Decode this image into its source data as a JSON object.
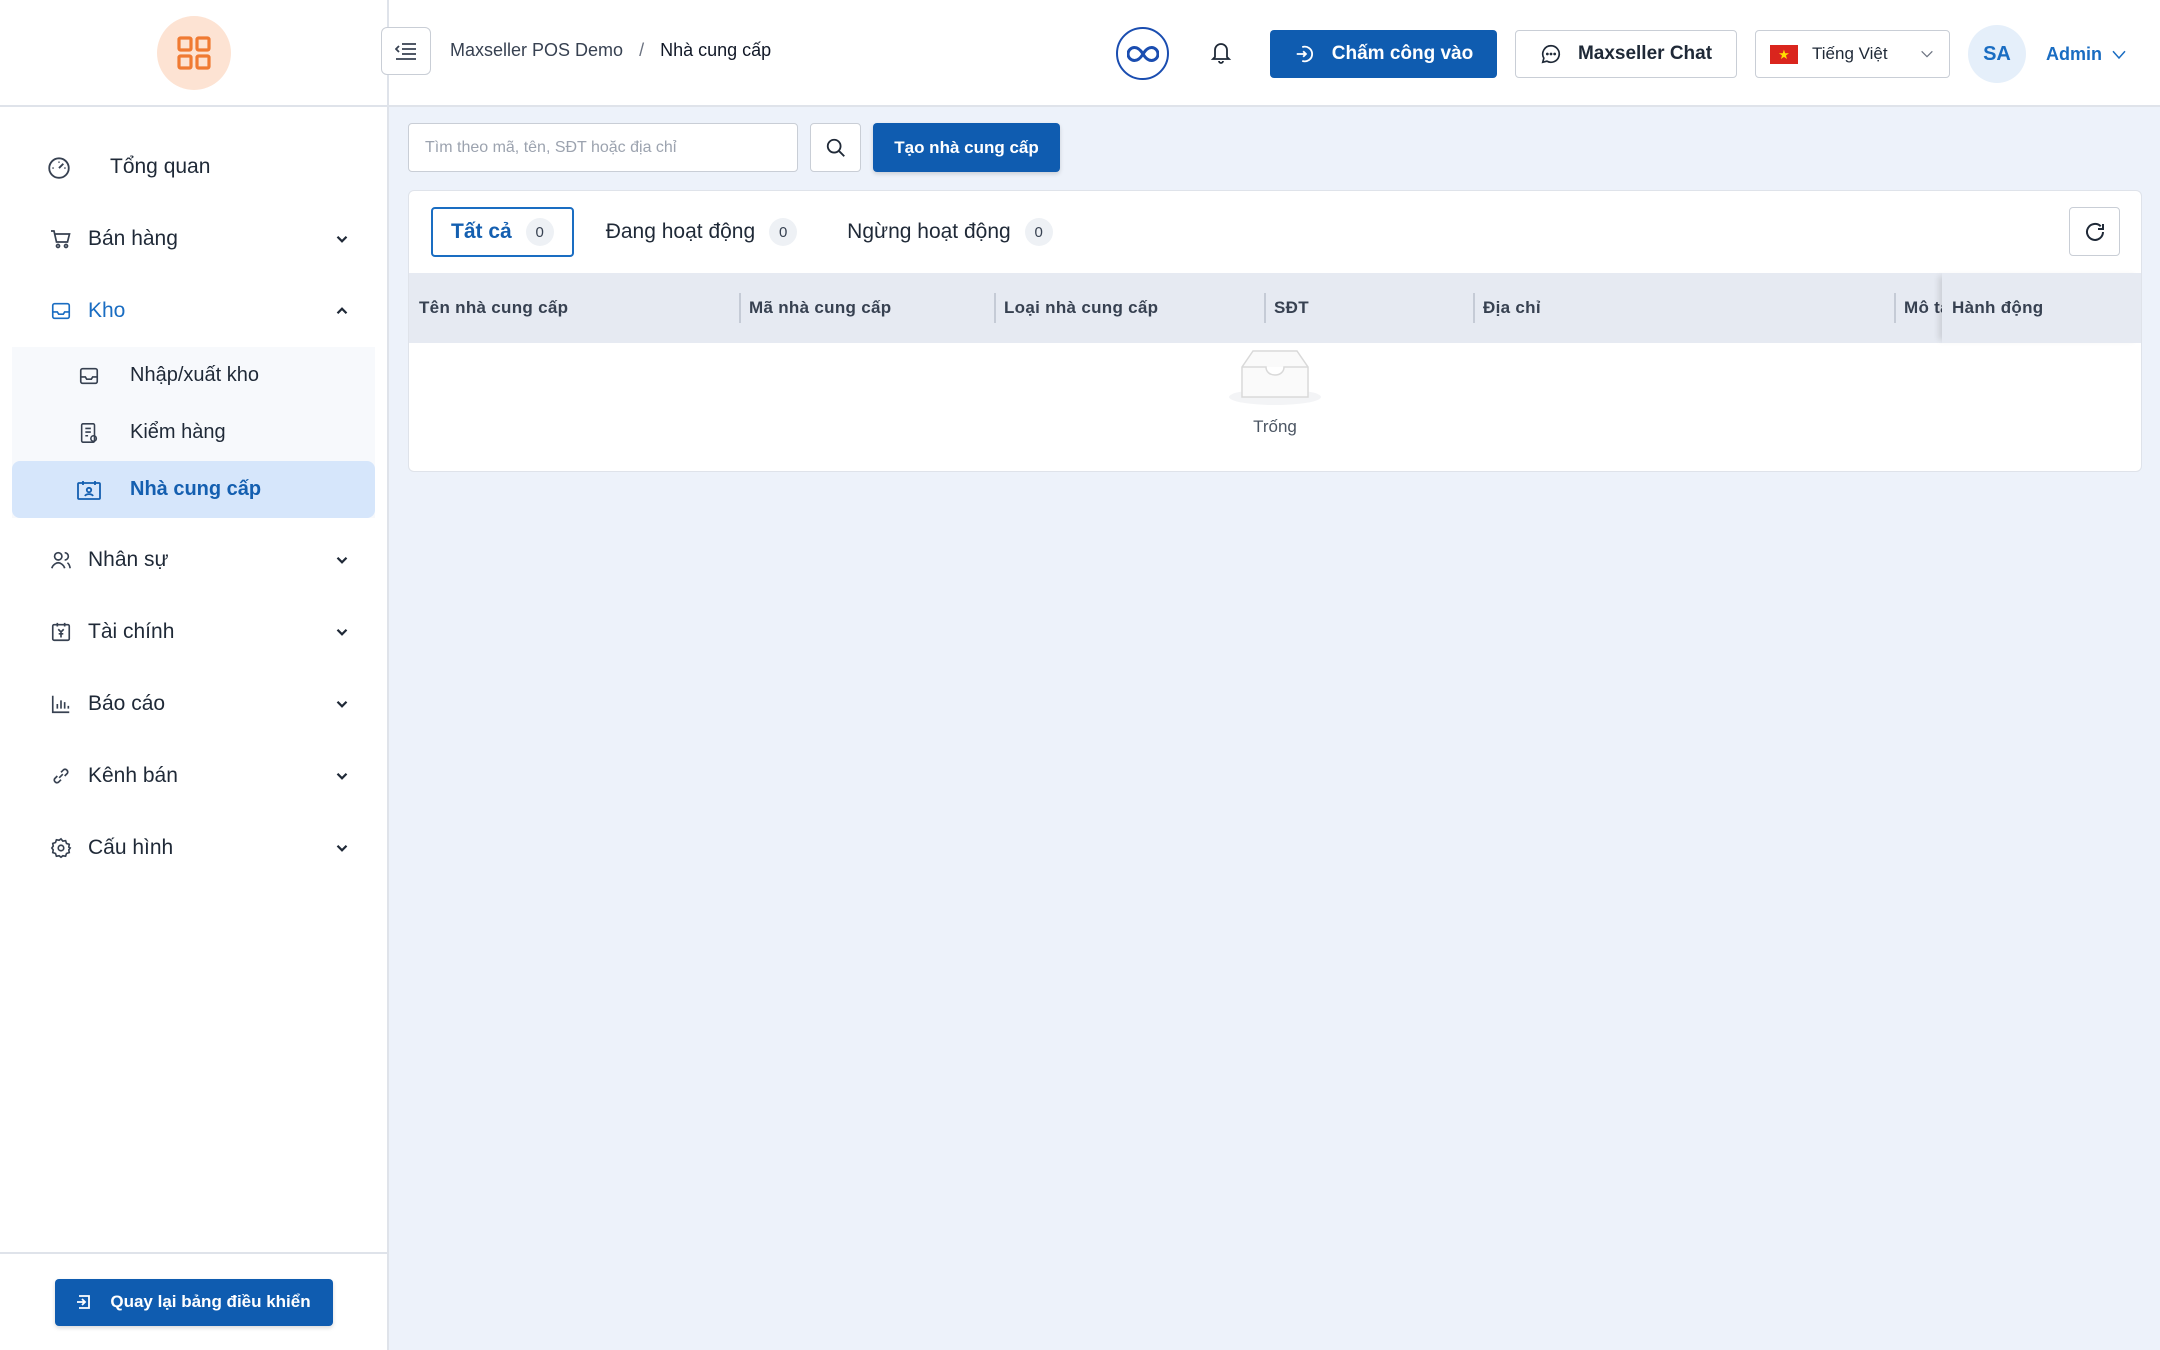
{
  "header": {
    "breadcrumb": [
      "Maxseller POS Demo",
      "Nhà cung cấp"
    ],
    "breadcrumb_sep": "/",
    "checkin_label": "Chấm công vào",
    "chat_label": "Maxseller Chat",
    "language": "Tiếng Việt",
    "avatar_initials": "SA",
    "user_name": "Admin"
  },
  "sidebar": {
    "items": [
      {
        "label": "Tổng quan",
        "icon": "dashboard-icon"
      },
      {
        "label": "Bán hàng",
        "icon": "cart-icon"
      },
      {
        "label": "Kho",
        "icon": "inbox-icon"
      },
      {
        "label": "Nhân sự",
        "icon": "users-icon"
      },
      {
        "label": "Tài chính",
        "icon": "finance-icon"
      },
      {
        "label": "Báo cáo",
        "icon": "bar-chart-icon"
      },
      {
        "label": "Kênh bán",
        "icon": "link-icon"
      },
      {
        "label": "Cấu hình",
        "icon": "gear-icon"
      }
    ],
    "kho_sub": [
      {
        "label": "Nhập/xuất kho",
        "icon": "inbox-icon"
      },
      {
        "label": "Kiểm hàng",
        "icon": "checklist-icon"
      },
      {
        "label": "Nhà cung cấp",
        "icon": "supplier-icon"
      }
    ],
    "back_label": "Quay lại bảng điều khiển"
  },
  "toolbar": {
    "search_placeholder": "Tìm theo mã, tên, SĐT hoặc địa chỉ",
    "create_label": "Tạo nhà cung cấp"
  },
  "tabs": [
    {
      "label": "Tất cả",
      "count": "0"
    },
    {
      "label": "Đang hoạt động",
      "count": "0"
    },
    {
      "label": "Ngừng hoạt động",
      "count": "0"
    }
  ],
  "table": {
    "columns": [
      "Tên nhà cung cấp",
      "Mã nhà cung cấp",
      "Loại nhà cung cấp",
      "SĐT",
      "Địa chỉ",
      "Mô tả",
      "Hành động"
    ],
    "empty_label": "Trống"
  },
  "colors": {
    "primary": "#0f5cb0",
    "accent": "#1a6dc2",
    "logo_orange": "#f07a32",
    "logo_bg": "#fde3d3"
  }
}
